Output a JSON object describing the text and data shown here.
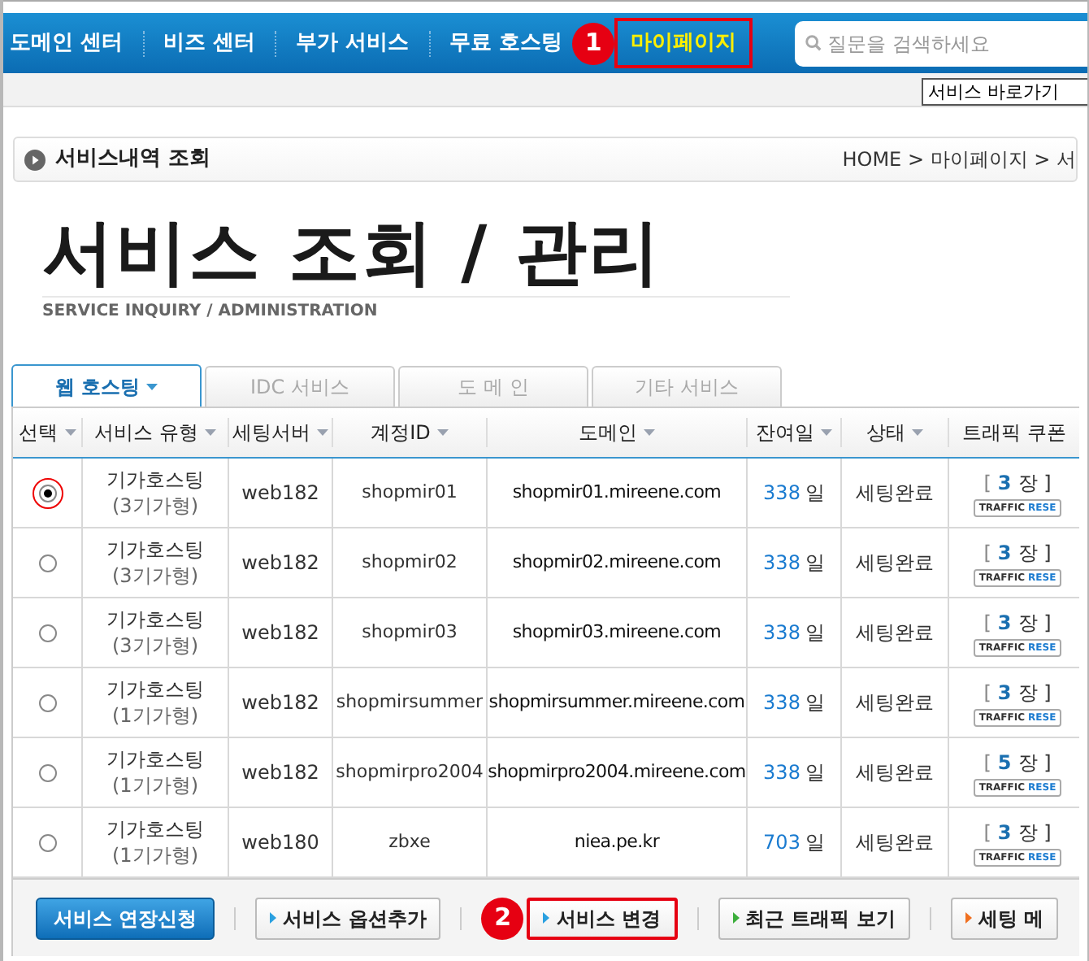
{
  "nav": {
    "items": [
      {
        "label": "도메인 센터",
        "selected": false
      },
      {
        "label": "비즈 센터",
        "selected": false
      },
      {
        "label": "부가 서비스",
        "selected": false
      },
      {
        "label": "무료 호스팅",
        "selected": false
      },
      {
        "label": "마이페이지",
        "selected": true,
        "callout": "1"
      }
    ],
    "search": {
      "placeholder": "질문을 검색하세요"
    },
    "shortcut_select": {
      "value": "서비스 바로가기"
    }
  },
  "section_bar": {
    "title": "서비스내역 조회",
    "breadcrumb": "HOME > 마이페이지 > 서"
  },
  "heading": {
    "title": "서비스 조회 / 관리",
    "subtitle": "SERVICE INQUIRY / ADMINISTRATION"
  },
  "tabs": [
    {
      "label": "웹 호스팅",
      "selected": true
    },
    {
      "label": "IDC 서비스",
      "selected": false
    },
    {
      "label": "도 메 인",
      "selected": false
    },
    {
      "label": "기타 서비스",
      "selected": false
    }
  ],
  "table": {
    "columns": [
      {
        "label": "선택",
        "sortable": true
      },
      {
        "label": "서비스 유형",
        "sortable": true
      },
      {
        "label": "세팅서버",
        "sortable": true
      },
      {
        "label": "계정ID",
        "sortable": true
      },
      {
        "label": "도메인",
        "sortable": true
      },
      {
        "label": "잔여일",
        "sortable": true
      },
      {
        "label": "상태",
        "sortable": true
      },
      {
        "label": "트래픽 쿠폰",
        "sortable": false
      }
    ],
    "rows": [
      {
        "selected": true,
        "type": "기가호스팅",
        "plan": "(3기가형)",
        "server": "web182",
        "account": "shopmir01",
        "domain": "shopmir01.mireene.com",
        "days": "338",
        "days_unit": "일",
        "status": "세팅완료",
        "coupon_open": "[",
        "coupon_count": "3",
        "coupon_unit": "장 ]",
        "coupon_badge_a": "TRAFFIC",
        "coupon_badge_b": "RESE"
      },
      {
        "selected": false,
        "type": "기가호스팅",
        "plan": "(3기가형)",
        "server": "web182",
        "account": "shopmir02",
        "domain": "shopmir02.mireene.com",
        "days": "338",
        "days_unit": "일",
        "status": "세팅완료",
        "coupon_open": "[",
        "coupon_count": "3",
        "coupon_unit": "장 ]",
        "coupon_badge_a": "TRAFFIC",
        "coupon_badge_b": "RESE"
      },
      {
        "selected": false,
        "type": "기가호스팅",
        "plan": "(3기가형)",
        "server": "web182",
        "account": "shopmir03",
        "domain": "shopmir03.mireene.com",
        "days": "338",
        "days_unit": "일",
        "status": "세팅완료",
        "coupon_open": "[",
        "coupon_count": "3",
        "coupon_unit": "장 ]",
        "coupon_badge_a": "TRAFFIC",
        "coupon_badge_b": "RESE"
      },
      {
        "selected": false,
        "type": "기가호스팅",
        "plan": "(1기가형)",
        "server": "web182",
        "account": "shopmirsummer",
        "domain": "shopmirsummer.mireene.com",
        "days": "338",
        "days_unit": "일",
        "status": "세팅완료",
        "coupon_open": "[",
        "coupon_count": "3",
        "coupon_unit": "장 ]",
        "coupon_badge_a": "TRAFFIC",
        "coupon_badge_b": "RESE"
      },
      {
        "selected": false,
        "type": "기가호스팅",
        "plan": "(1기가형)",
        "server": "web182",
        "account": "shopmirpro2004",
        "domain": "shopmirpro2004.mireene.com",
        "days": "338",
        "days_unit": "일",
        "status": "세팅완료",
        "coupon_open": "[",
        "coupon_count": "5",
        "coupon_unit": "장 ]",
        "coupon_badge_a": "TRAFFIC",
        "coupon_badge_b": "RESE"
      },
      {
        "selected": false,
        "type": "기가호스팅",
        "plan": "(1기가형)",
        "server": "web180",
        "account": "zbxe",
        "domain": "niea.pe.kr",
        "days": "703",
        "days_unit": "일",
        "status": "세팅완료",
        "coupon_open": "[",
        "coupon_count": "3",
        "coupon_unit": "장 ]",
        "coupon_badge_a": "TRAFFIC",
        "coupon_badge_b": "RESE"
      }
    ]
  },
  "buttons": [
    {
      "label": "서비스 연장신청",
      "kind": "primary"
    },
    {
      "label": "서비스 옵션추가",
      "kind": "secondary",
      "color": "#2aa0e0"
    },
    {
      "label": "서비스 변경",
      "kind": "secondary",
      "color": "#2aa0e0",
      "callout": "2"
    },
    {
      "label": "최근 트래픽 보기",
      "kind": "secondary",
      "color": "#3cae3c"
    },
    {
      "label": "세팅 메",
      "kind": "secondary",
      "color": "#f07020"
    }
  ]
}
